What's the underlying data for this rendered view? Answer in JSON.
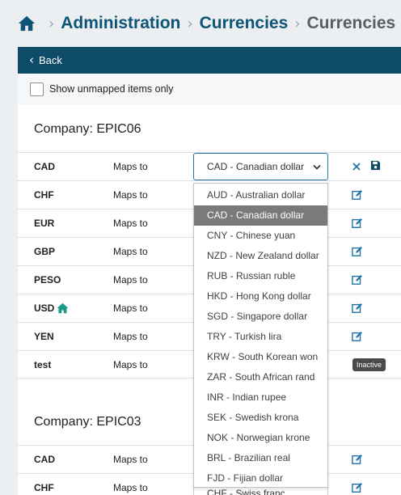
{
  "breadcrumb": {
    "items": [
      "Administration",
      "Currencies"
    ],
    "current": "Currencies Ma"
  },
  "header": {
    "back_label": "Back"
  },
  "filter": {
    "unmapped_label": "Show unmapped items only"
  },
  "maps_to_label": "Maps to",
  "companies": [
    {
      "title": "Company: EPIC06",
      "rows": [
        {
          "code": "CAD"
        },
        {
          "code": "CHF"
        },
        {
          "code": "EUR"
        },
        {
          "code": "GBP"
        },
        {
          "code": "PESO"
        },
        {
          "code": "USD"
        },
        {
          "code": "YEN"
        },
        {
          "code": "test"
        }
      ]
    },
    {
      "title": "Company: EPIC03",
      "rows": [
        {
          "code": "CAD"
        },
        {
          "code": "CHF"
        }
      ]
    }
  ],
  "editing_select": {
    "value": "CAD - Canadian dollar"
  },
  "partial_select": {
    "value": "CHF - Swiss franc"
  },
  "inactive_badge": "Inactive",
  "dropdown": {
    "selected": "CAD - Canadian dollar",
    "options": [
      "AUD - Australian dollar",
      "CAD - Canadian dollar",
      "CNY - Chinese yuan",
      "NZD - New Zealand dollar",
      "RUB - Russian ruble",
      "HKD - Hong Kong dollar",
      "SGD - Singapore dollar",
      "TRY - Turkish lira",
      "KRW - South Korean won",
      "ZAR - South African rand",
      "INR - Indian rupee",
      "SEK - Swedish krona",
      "NOK - Norwegian krone",
      "BRL - Brazilian real",
      "FJD - Fijian dollar"
    ]
  },
  "colors": {
    "brand": "#0d4b66",
    "link": "#0e5476",
    "icon_blue": "#1f73a8",
    "home_green": "#1a9a86",
    "selected_option_bg": "#7a7a7a"
  },
  "icons": {
    "home": "home-icon",
    "back": "chevron-left-icon",
    "edit": "edit-icon",
    "cancel": "close-icon",
    "save": "save-icon",
    "caret": "chevron-down-icon",
    "default_currency": "home-icon"
  }
}
